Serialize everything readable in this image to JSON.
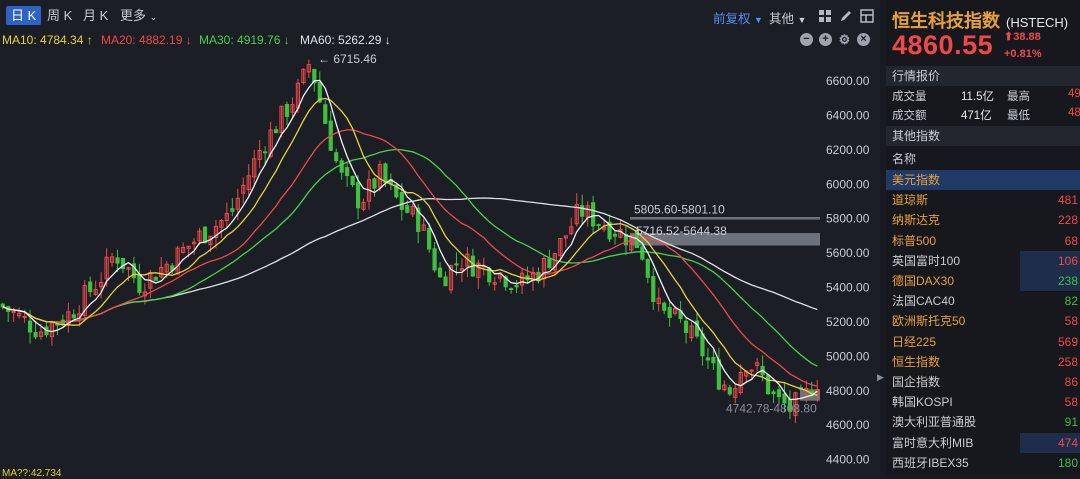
{
  "toolbar": {
    "tabs": [
      {
        "label": "日 K",
        "active": true
      },
      {
        "label": "周 K",
        "active": false
      },
      {
        "label": "月 K",
        "active": false
      },
      {
        "label": "更多",
        "active": false
      }
    ],
    "adjust_label": "前复权",
    "other_label": "其他"
  },
  "ma": [
    {
      "label": "MA10: 4784.34 ↑",
      "color": "#e7d23a"
    },
    {
      "label": "MA20: 4882.19 ↓",
      "color": "#f04848"
    },
    {
      "label": "MA30: 4919.76 ↓",
      "color": "#4cd04c"
    },
    {
      "label": "MA60: 5262.29 ↓",
      "color": "#dfe1e6"
    }
  ],
  "chart_data": {
    "type": "candlestick",
    "y_ticks": [
      "6600.00",
      "6400.00",
      "6200.00",
      "6000.00",
      "5800.00",
      "5600.00",
      "5400.00",
      "5200.00",
      "5000.00",
      "4800.00",
      "4600.00",
      "4400.00"
    ],
    "ylim": [
      4340,
      6780
    ],
    "annotations": [
      "6715.46",
      "5805.60-5801.10",
      "5716.52-5644.38",
      "4742.78-4808.80"
    ],
    "peak_value": 6715.46,
    "gap_zones": [
      [
        5801.1,
        5805.6
      ],
      [
        5644.38,
        5716.52
      ],
      [
        4742.78,
        4808.8
      ]
    ],
    "series_colors": {
      "up": "#f04848",
      "down": "#3fc03f",
      "ma10": "#e7d23a",
      "ma20": "#f04848",
      "ma30": "#4cd04c",
      "ma60": "#dfe1e6",
      "ma5": "#f2f2f2"
    },
    "bottom_label": "MA??:42.734"
  },
  "quote": {
    "name": "恒生科技指数",
    "code": "(HSTECH)",
    "price": "4860.55",
    "change": "38.88",
    "change_pct": "+0.81%",
    "section_quote": "行情报价",
    "stats": [
      {
        "label": "成交量",
        "value": "11.5亿",
        "label2": "最高",
        "value2": "49"
      },
      {
        "label": "成交额",
        "value": "471亿",
        "label2": "最低",
        "value2": "48"
      }
    ],
    "section_other": "其他指数",
    "col_name": "名称",
    "indices": [
      {
        "name": "美元指数",
        "value": "",
        "name_color": "#e8a03c",
        "val_color": "#f04848",
        "highlight": true
      },
      {
        "name": "道琼斯",
        "value": "481",
        "name_color": "#e8a03c",
        "val_color": "#f04848",
        "highlight": false
      },
      {
        "name": "纳斯达克",
        "value": "228",
        "name_color": "#e8a03c",
        "val_color": "#f04848",
        "highlight": false
      },
      {
        "name": "标普500",
        "value": "68",
        "name_color": "#e8a03c",
        "val_color": "#f04848",
        "highlight": false
      },
      {
        "name": "英国富时100",
        "value": "106",
        "name_color": "#c9ccd3",
        "val_color": "#f04848",
        "highlight": true
      },
      {
        "name": "德国DAX30",
        "value": "238",
        "name_color": "#e8a03c",
        "val_color": "#3fc03f",
        "highlight": true
      },
      {
        "name": "法国CAC40",
        "value": "82",
        "name_color": "#c9ccd3",
        "val_color": "#3fc03f",
        "highlight": false
      },
      {
        "name": "欧洲斯托克50",
        "value": "58",
        "name_color": "#e8a03c",
        "val_color": "#f04848",
        "highlight": false
      },
      {
        "name": "日经225",
        "value": "569",
        "name_color": "#e8a03c",
        "val_color": "#f04848",
        "highlight": false
      },
      {
        "name": "恒生指数",
        "value": "258",
        "name_color": "#e8a03c",
        "val_color": "#f04848",
        "highlight": false
      },
      {
        "name": "国企指数",
        "value": "86",
        "name_color": "#c9ccd3",
        "val_color": "#f04848",
        "highlight": false
      },
      {
        "name": "韩国KOSPI",
        "value": "58",
        "name_color": "#c9ccd3",
        "val_color": "#f04848",
        "highlight": false
      },
      {
        "name": "澳大利亚普通股",
        "value": "91",
        "name_color": "#c9ccd3",
        "val_color": "#3fc03f",
        "highlight": false
      },
      {
        "name": "富时意大利MIB",
        "value": "474",
        "name_color": "#c9ccd3",
        "val_color": "#f04848",
        "highlight": true
      },
      {
        "name": "西班牙IBEX35",
        "value": "180",
        "name_color": "#c9ccd3",
        "val_color": "#3fc03f",
        "highlight": false
      }
    ]
  }
}
